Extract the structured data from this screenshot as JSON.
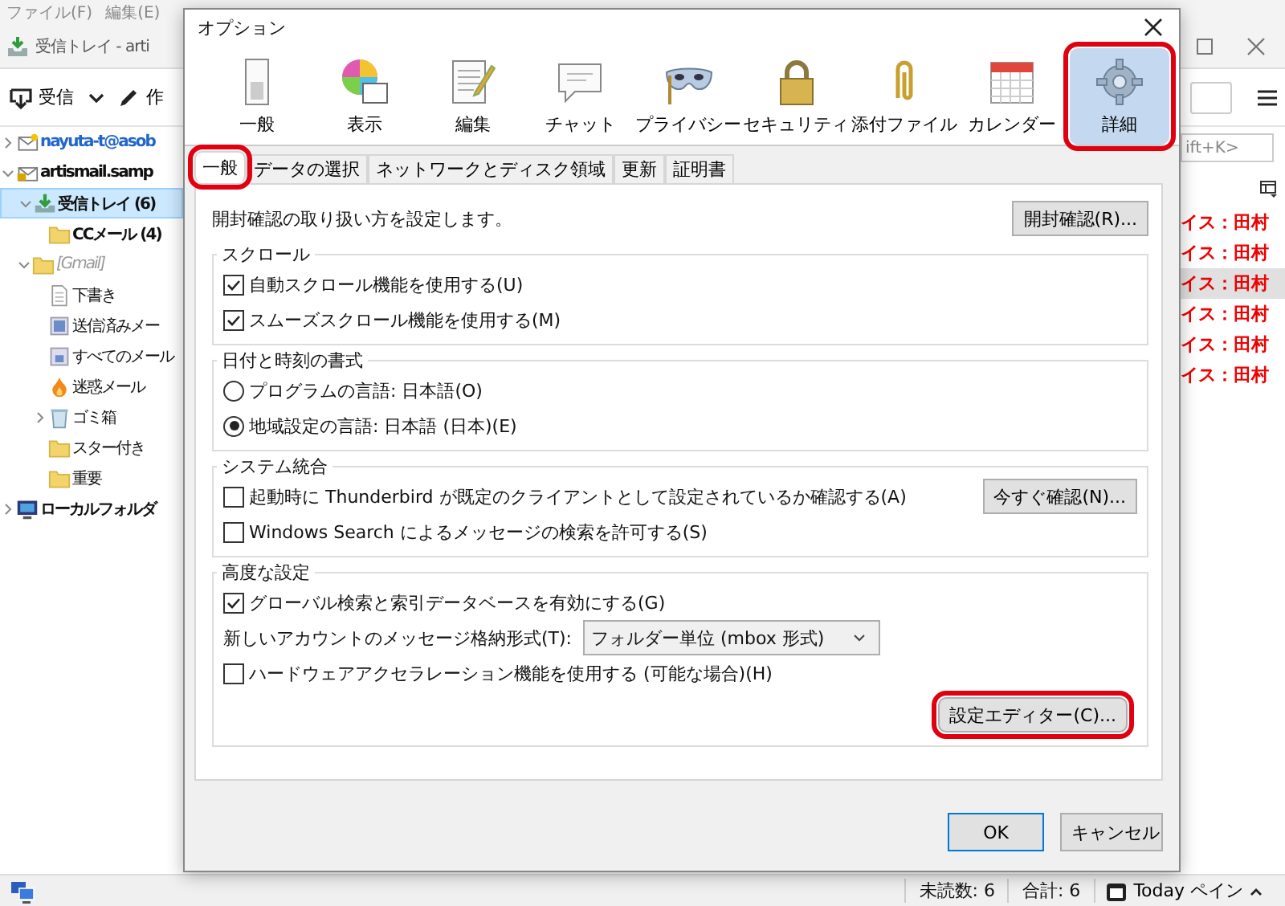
{
  "app": {
    "menu": [
      "ファイル(F)",
      "編集(E)"
    ],
    "tab_title": "受信トレイ - arti",
    "toolbar": [
      {
        "kind": "get",
        "label": "受信",
        "dropdown": true
      },
      {
        "kind": "write",
        "label": "作",
        "dropdown": false
      }
    ],
    "folders": [
      {
        "kind": "account",
        "label": "nayuta-t@asob",
        "expanded": false,
        "new_mail": true,
        "selected": false,
        "unread": true
      },
      {
        "kind": "account-locked",
        "label": "artismail.samp",
        "expanded": true,
        "new_mail": false,
        "selected": false,
        "unread": true,
        "children": [
          {
            "kind": "inbox",
            "label": "受信トレイ (6)",
            "expanded": true,
            "new_mail": false,
            "selected": true,
            "unread": true,
            "children": [
              {
                "kind": "folder",
                "label": "CCメール (4)",
                "new_mail": false,
                "selected": false,
                "unread": true
              }
            ]
          },
          {
            "kind": "gmail",
            "label": "[Gmail]",
            "expanded": true,
            "new_mail": false,
            "selected": false,
            "unread": false,
            "children": [
              {
                "kind": "drafts",
                "label": "下書き",
                "new_mail": false,
                "selected": false,
                "unread": false
              },
              {
                "kind": "sent",
                "label": "送信済みメー",
                "new_mail": false,
                "selected": false,
                "unread": false
              },
              {
                "kind": "archive",
                "label": "すべてのメール",
                "new_mail": false,
                "selected": false,
                "unread": false
              },
              {
                "kind": "junk",
                "label": "迷惑メール",
                "new_mail": false,
                "selected": false,
                "unread": false
              },
              {
                "kind": "trash",
                "label": "ゴミ箱",
                "expanded": false,
                "new_mail": false,
                "selected": false,
                "unread": false
              },
              {
                "kind": "folder",
                "label": "スター付き",
                "new_mail": false,
                "selected": false,
                "unread": false
              },
              {
                "kind": "folder",
                "label": "重要",
                "new_mail": false,
                "selected": false,
                "unread": false
              }
            ]
          }
        ]
      },
      {
        "kind": "local",
        "label": "ローカルフォルダ",
        "expanded": false,
        "new_mail": false,
        "selected": false,
        "unread": true
      }
    ],
    "quick_filter": {
      "placeholder": "ift+K>"
    },
    "messages": [
      {
        "text": "イス：田村",
        "selected": false
      },
      {
        "text": "イス：田村",
        "selected": false
      },
      {
        "text": "イス：田村",
        "selected": true
      },
      {
        "text": "イス：田村",
        "selected": false
      },
      {
        "text": "イス：田村",
        "selected": false
      },
      {
        "text": "イス：田村",
        "selected": false
      }
    ],
    "status": {
      "unread": "未読数: 6",
      "total": "合計: 6",
      "today": "Today ペイン"
    }
  },
  "dialog": {
    "title": "オプション",
    "panes": [
      {
        "kind": "general",
        "label": "一般",
        "selected": false,
        "highlighted": false
      },
      {
        "kind": "display",
        "label": "表示",
        "selected": false,
        "highlighted": false
      },
      {
        "kind": "compose",
        "label": "編集",
        "selected": false,
        "highlighted": false
      },
      {
        "kind": "chat",
        "label": "チャット",
        "selected": false,
        "highlighted": false
      },
      {
        "kind": "privacy",
        "label": "プライバシー",
        "selected": false,
        "highlighted": false
      },
      {
        "kind": "security",
        "label": "セキュリティ",
        "selected": false,
        "highlighted": false
      },
      {
        "kind": "attachments",
        "label": "添付ファイル",
        "selected": false,
        "highlighted": false
      },
      {
        "kind": "calendar",
        "label": "カレンダー",
        "selected": false,
        "highlighted": false
      },
      {
        "kind": "advanced",
        "label": "詳細",
        "selected": true,
        "highlighted": true
      }
    ],
    "tabs": [
      {
        "label": "一般",
        "selected": true,
        "highlighted": true
      },
      {
        "label": "データの選択",
        "selected": false,
        "highlighted": false
      },
      {
        "label": "ネットワークとディスク領域",
        "selected": false,
        "highlighted": false
      },
      {
        "label": "更新",
        "selected": false,
        "highlighted": false
      },
      {
        "label": "証明書",
        "selected": false,
        "highlighted": false
      }
    ],
    "intro": {
      "text": "開封確認の取り扱い方を設定します。",
      "button": "開封確認(R)..."
    },
    "groups": [
      {
        "title": "スクロール",
        "items": [
          {
            "kind": "checkbox",
            "label": "自動スクロール機能を使用する(U)",
            "checked": true
          },
          {
            "kind": "checkbox",
            "label": "スムーズスクロール機能を使用する(M)",
            "checked": true
          }
        ]
      },
      {
        "title": "日付と時刻の書式",
        "items": [
          {
            "kind": "radio",
            "label": "プログラムの言語: 日本語(O)",
            "selected": false
          },
          {
            "kind": "radio",
            "label": "地域設定の言語: 日本語 (日本)(E)",
            "selected": true
          }
        ]
      },
      {
        "title": "システム統合",
        "items": [
          {
            "kind": "checkbox",
            "label": "起動時に Thunderbird が既定のクライアントとして設定されているか確認する(A)",
            "checked": false,
            "button": "今すぐ確認(N)..."
          },
          {
            "kind": "checkbox",
            "label": "Windows Search によるメッセージの検索を許可する(S)",
            "checked": false
          }
        ]
      },
      {
        "title": "高度な設定",
        "items": [
          {
            "kind": "checkbox",
            "label": "グローバル検索と索引データベースを有効にする(G)",
            "checked": true
          },
          {
            "kind": "select",
            "label": "新しいアカウントのメッセージ格納形式(T):",
            "value": "フォルダー単位 (mbox 形式)"
          },
          {
            "kind": "checkbox",
            "label": "ハードウェアアクセラレーション機能を使用する (可能な場合)(H)",
            "checked": false
          }
        ],
        "button": {
          "label": "設定エディター(C)...",
          "highlighted": true
        }
      }
    ],
    "buttons": [
      {
        "label": "OK",
        "default": true
      },
      {
        "label": "キャンセル",
        "default": false
      }
    ]
  }
}
